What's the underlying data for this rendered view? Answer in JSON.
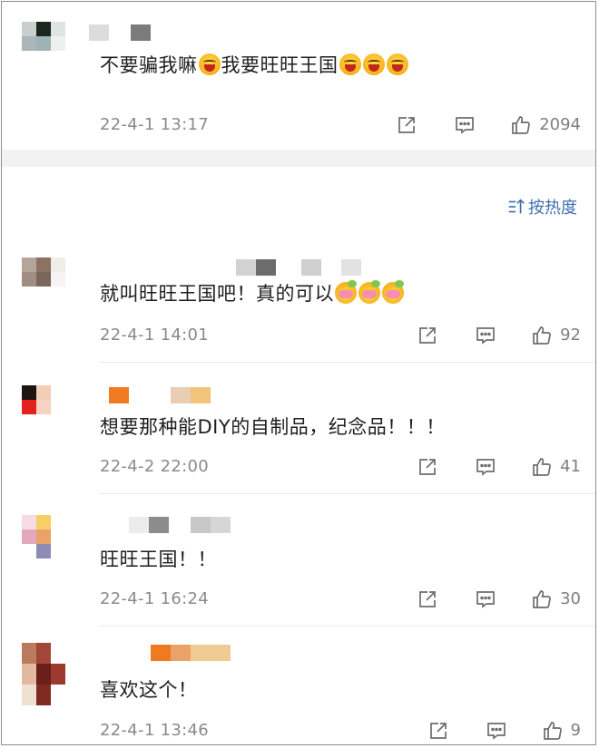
{
  "sort": {
    "label": "按热度",
    "icon": "sort-icon"
  },
  "colors": {
    "accent": "#3f6fb1",
    "meta": "#8a8a8a"
  },
  "comments": [
    {
      "text": "不要骗我嘛",
      "text2": "我要旺旺王国",
      "time": "22-4-1 13:17",
      "likes": "2094"
    },
    {
      "text": "就叫旺旺王国吧！真的可以",
      "time": "22-4-1 14:01",
      "likes": "92"
    },
    {
      "text": "想要那种能DIY的自制品，纪念品！！！",
      "time": "22-4-2 22:00",
      "likes": "41"
    },
    {
      "text": "旺旺王国！！",
      "time": "22-4-1 16:24",
      "likes": "30"
    },
    {
      "text": "喜欢这个！",
      "time": "22-4-1 13:46",
      "likes": "9"
    }
  ]
}
